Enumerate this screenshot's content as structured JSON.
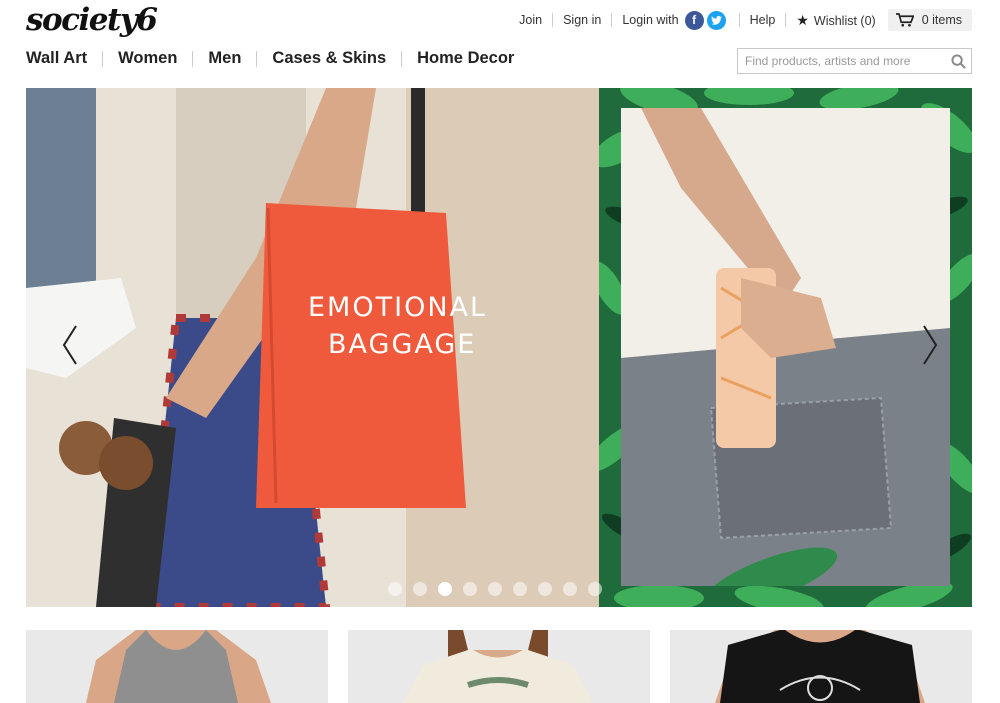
{
  "brand": {
    "logo_text": "society6"
  },
  "topbar": {
    "join": "Join",
    "sign_in": "Sign in",
    "login_with": "Login with",
    "facebook_icon": "f",
    "twitter_icon": "t",
    "help": "Help",
    "wishlist": "Wishlist (0)",
    "cart": "0 items"
  },
  "nav": {
    "items": [
      "Wall Art",
      "Women",
      "Men",
      "Cases & Skins",
      "Home Decor"
    ]
  },
  "search": {
    "placeholder": "Find products, artists and more",
    "value": ""
  },
  "hero": {
    "slide_left_text_line1": "EMOTIONAL",
    "slide_left_text_line2": "BAGGAGE",
    "slides_count": 9,
    "active_slide": 3
  },
  "icons": {
    "prev": "chevron-left-icon",
    "next": "chevron-right-icon",
    "search": "search-icon",
    "cart": "cart-icon",
    "wishlist": "star-icon"
  },
  "colors": {
    "facebook": "#3b5998",
    "twitter": "#1da1f2",
    "tote": "#ef5a3c",
    "leaf": "#2a7a46"
  },
  "products": [
    {
      "type": "grey tank top"
    },
    {
      "type": "cream t-shirt"
    },
    {
      "type": "black muscle tank"
    }
  ]
}
